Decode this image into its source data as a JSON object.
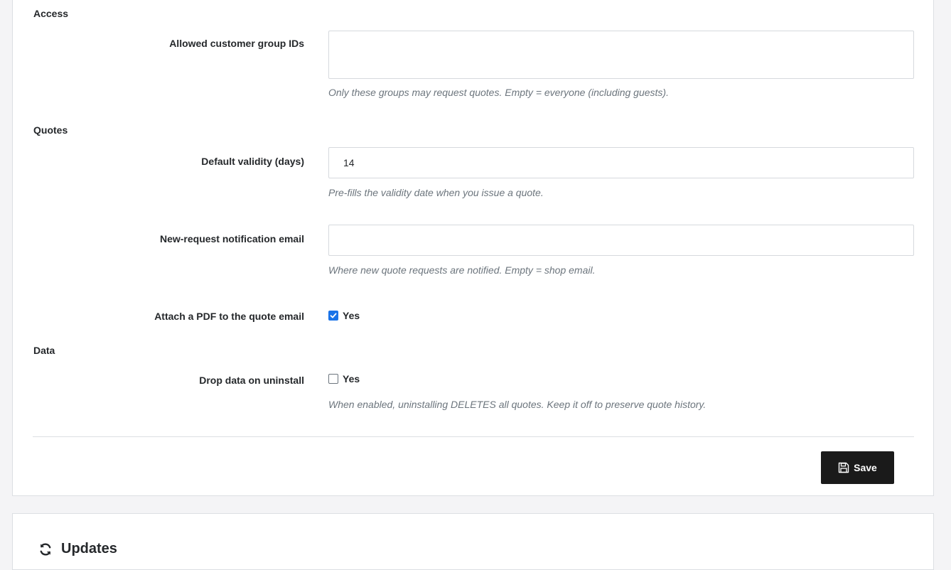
{
  "settings": {
    "sections": {
      "access": "Access",
      "quotes": "Quotes",
      "data": "Data"
    },
    "allowed_groups": {
      "label": "Allowed customer group IDs",
      "value": "",
      "help": "Only these groups may request quotes. Empty = everyone (including guests)."
    },
    "default_validity": {
      "label": "Default validity (days)",
      "value": "14",
      "help": "Pre-fills the validity date when you issue a quote."
    },
    "notification_email": {
      "label": "New-request notification email",
      "value": "",
      "help": "Where new quote requests are notified. Empty = shop email."
    },
    "attach_pdf": {
      "label": "Attach a PDF to the quote email",
      "option_label": "Yes",
      "checked": true
    },
    "drop_data": {
      "label": "Drop data on uninstall",
      "option_label": "Yes",
      "checked": false,
      "help": "When enabled, uninstalling DELETES all quotes. Keep it off to preserve quote history."
    },
    "save_label": "Save"
  },
  "updates": {
    "title": "Updates",
    "icon": "refresh-icon"
  },
  "colors": {
    "accent": "#1a73e8",
    "button_bg": "#1a1a1a",
    "help_text": "#6c757d",
    "border": "#dcdfe3"
  }
}
